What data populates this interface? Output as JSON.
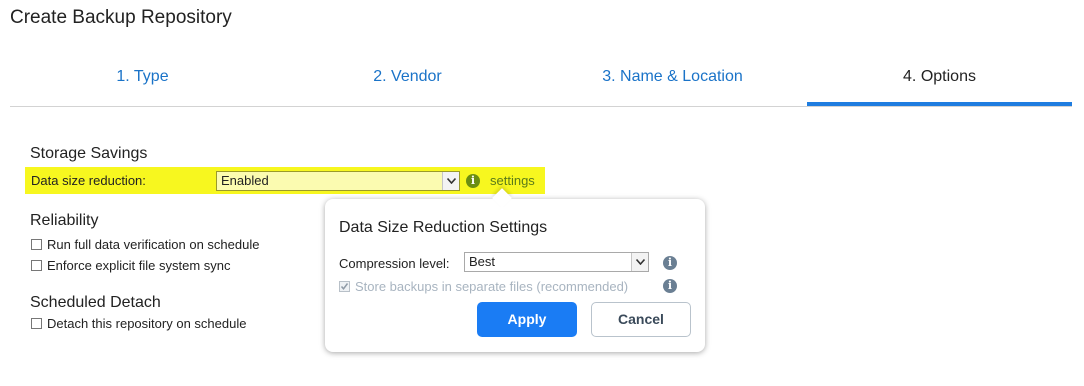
{
  "page": {
    "title": "Create Backup Repository"
  },
  "tabs": [
    {
      "label": "1. Type",
      "active": false
    },
    {
      "label": "2. Vendor",
      "active": false
    },
    {
      "label": "3. Name & Location",
      "active": false
    },
    {
      "label": "4. Options",
      "active": true
    }
  ],
  "storage_savings": {
    "title": "Storage Savings",
    "data_size_label": "Data size reduction:",
    "data_size_value": "Enabled",
    "settings_link": "settings"
  },
  "reliability": {
    "title": "Reliability",
    "items": [
      {
        "label": "Run full data verification on schedule",
        "checked": false
      },
      {
        "label": "Enforce explicit file system sync",
        "checked": false
      }
    ]
  },
  "scheduled_detach": {
    "title": "Scheduled Detach",
    "items": [
      {
        "label": "Detach this repository on schedule",
        "checked": false
      }
    ]
  },
  "popup": {
    "title": "Data Size Reduction Settings",
    "compression_label": "Compression level:",
    "compression_value": "Best",
    "separate_files_label": "Store backups in separate files (recommended)",
    "separate_files_checked": true,
    "separate_files_disabled": true,
    "apply_label": "Apply",
    "cancel_label": "Cancel"
  },
  "colors": {
    "accent": "#1f7de0",
    "highlight": "#f7f71f",
    "info_green": "#6b8e12",
    "info_blue": "#6a7f93"
  },
  "icons": {
    "dropdown": "chevron-down-icon",
    "info": "info-icon",
    "check": "checkmark-icon"
  }
}
